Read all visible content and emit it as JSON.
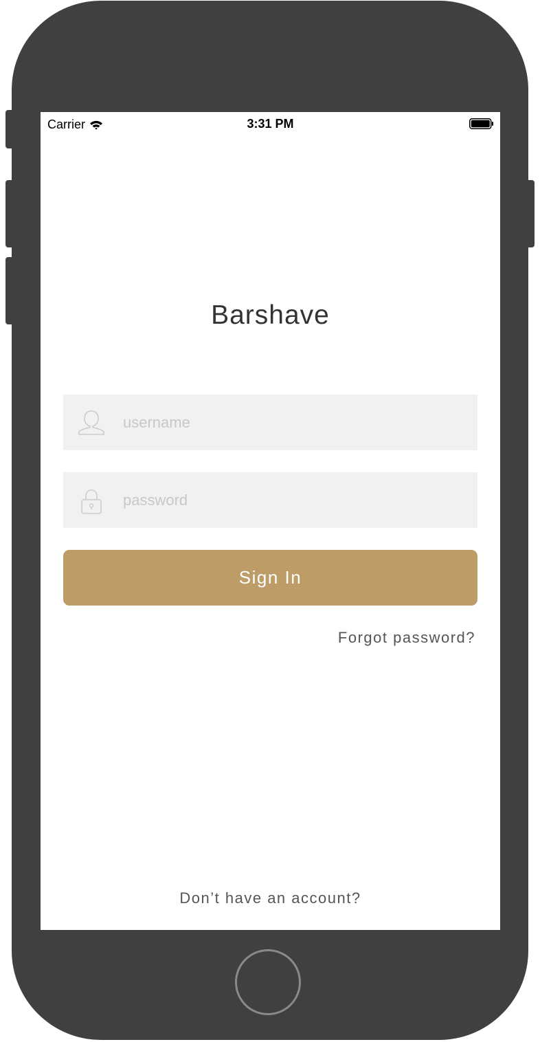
{
  "status_bar": {
    "carrier": "Carrier",
    "time": "3:31 PM",
    "wifi_icon": "wifi-icon",
    "battery_icon": "battery-icon"
  },
  "login": {
    "title": "Barshave",
    "username": {
      "placeholder": "username",
      "value": "",
      "icon": "user-icon"
    },
    "password": {
      "placeholder": "password",
      "value": "",
      "icon": "lock-icon"
    },
    "sign_in_label": "Sign In",
    "forgot_label": "Forgot password?",
    "signup_label": "Don’t have an account?"
  },
  "colors": {
    "accent": "#be9c68",
    "device": "#404040",
    "field_bg": "#f1f1f1",
    "text_dark": "#333333",
    "text_muted": "#555555",
    "placeholder": "#c8c8c8"
  }
}
